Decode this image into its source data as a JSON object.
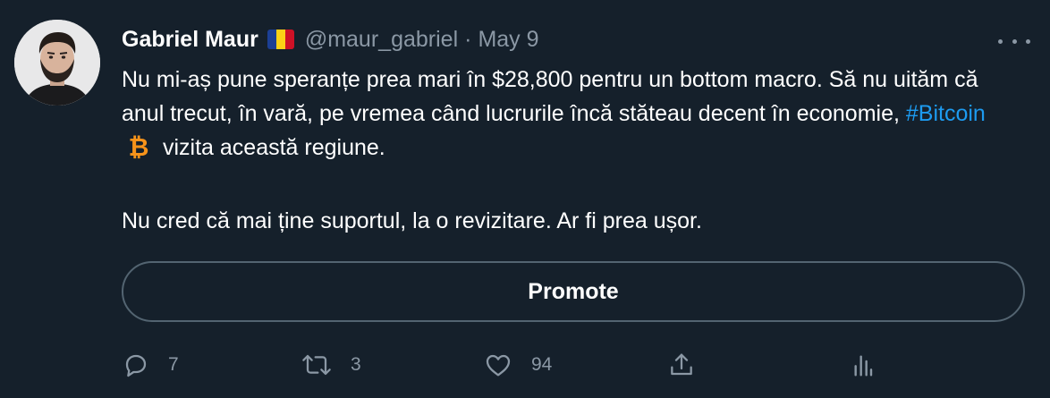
{
  "tweet": {
    "author_name": "Gabriel Maur",
    "flag_icon": "romania-flag-icon",
    "handle": "@maur_gabriel",
    "separator": "·",
    "date": "May 9",
    "text_line1_before_hashtag": "Nu mi-aș pune speranțe prea mari în $28,800 pentru un bottom macro. Să nu uităm că anul trecut, în vară, pe vremea când lucrurile încă stăteau decent în economie, ",
    "hashtag": "#Bitcoin",
    "text_line1_after_hashtag": "vizita această regiune.",
    "paragraph2": "Nu cred că mai ține suportul, la o revizitare. Ar fi prea ușor.",
    "promote_label": "Promote",
    "replies": "7",
    "retweets": "3",
    "likes": "94"
  },
  "colors": {
    "background": "#15202b",
    "text": "#ffffff",
    "muted": "#8b98a5",
    "link": "#1d9bf0",
    "border": "#536471",
    "bitcoin": "#f7931a"
  },
  "icons": {
    "more": "more-dots-icon",
    "reply": "reply-icon",
    "retweet": "retweet-icon",
    "like": "heart-icon",
    "share": "share-icon",
    "analytics": "analytics-icon",
    "bitcoin": "bitcoin-emoji-icon"
  }
}
